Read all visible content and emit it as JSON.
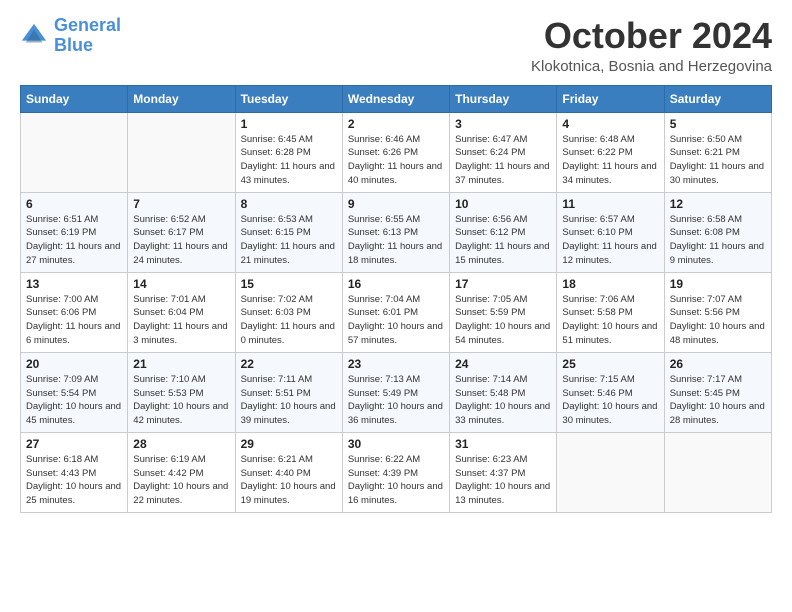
{
  "logo": {
    "line1": "General",
    "line2": "Blue"
  },
  "header": {
    "month": "October 2024",
    "location": "Klokotnica, Bosnia and Herzegovina"
  },
  "weekdays": [
    "Sunday",
    "Monday",
    "Tuesday",
    "Wednesday",
    "Thursday",
    "Friday",
    "Saturday"
  ],
  "weeks": [
    [
      null,
      null,
      {
        "day": "1",
        "sunrise": "6:45 AM",
        "sunset": "6:28 PM",
        "daylight": "11 hours and 43 minutes."
      },
      {
        "day": "2",
        "sunrise": "6:46 AM",
        "sunset": "6:26 PM",
        "daylight": "11 hours and 40 minutes."
      },
      {
        "day": "3",
        "sunrise": "6:47 AM",
        "sunset": "6:24 PM",
        "daylight": "11 hours and 37 minutes."
      },
      {
        "day": "4",
        "sunrise": "6:48 AM",
        "sunset": "6:22 PM",
        "daylight": "11 hours and 34 minutes."
      },
      {
        "day": "5",
        "sunrise": "6:50 AM",
        "sunset": "6:21 PM",
        "daylight": "11 hours and 30 minutes."
      }
    ],
    [
      {
        "day": "6",
        "sunrise": "6:51 AM",
        "sunset": "6:19 PM",
        "daylight": "11 hours and 27 minutes."
      },
      {
        "day": "7",
        "sunrise": "6:52 AM",
        "sunset": "6:17 PM",
        "daylight": "11 hours and 24 minutes."
      },
      {
        "day": "8",
        "sunrise": "6:53 AM",
        "sunset": "6:15 PM",
        "daylight": "11 hours and 21 minutes."
      },
      {
        "day": "9",
        "sunrise": "6:55 AM",
        "sunset": "6:13 PM",
        "daylight": "11 hours and 18 minutes."
      },
      {
        "day": "10",
        "sunrise": "6:56 AM",
        "sunset": "6:12 PM",
        "daylight": "11 hours and 15 minutes."
      },
      {
        "day": "11",
        "sunrise": "6:57 AM",
        "sunset": "6:10 PM",
        "daylight": "11 hours and 12 minutes."
      },
      {
        "day": "12",
        "sunrise": "6:58 AM",
        "sunset": "6:08 PM",
        "daylight": "11 hours and 9 minutes."
      }
    ],
    [
      {
        "day": "13",
        "sunrise": "7:00 AM",
        "sunset": "6:06 PM",
        "daylight": "11 hours and 6 minutes."
      },
      {
        "day": "14",
        "sunrise": "7:01 AM",
        "sunset": "6:04 PM",
        "daylight": "11 hours and 3 minutes."
      },
      {
        "day": "15",
        "sunrise": "7:02 AM",
        "sunset": "6:03 PM",
        "daylight": "11 hours and 0 minutes."
      },
      {
        "day": "16",
        "sunrise": "7:04 AM",
        "sunset": "6:01 PM",
        "daylight": "10 hours and 57 minutes."
      },
      {
        "day": "17",
        "sunrise": "7:05 AM",
        "sunset": "5:59 PM",
        "daylight": "10 hours and 54 minutes."
      },
      {
        "day": "18",
        "sunrise": "7:06 AM",
        "sunset": "5:58 PM",
        "daylight": "10 hours and 51 minutes."
      },
      {
        "day": "19",
        "sunrise": "7:07 AM",
        "sunset": "5:56 PM",
        "daylight": "10 hours and 48 minutes."
      }
    ],
    [
      {
        "day": "20",
        "sunrise": "7:09 AM",
        "sunset": "5:54 PM",
        "daylight": "10 hours and 45 minutes."
      },
      {
        "day": "21",
        "sunrise": "7:10 AM",
        "sunset": "5:53 PM",
        "daylight": "10 hours and 42 minutes."
      },
      {
        "day": "22",
        "sunrise": "7:11 AM",
        "sunset": "5:51 PM",
        "daylight": "10 hours and 39 minutes."
      },
      {
        "day": "23",
        "sunrise": "7:13 AM",
        "sunset": "5:49 PM",
        "daylight": "10 hours and 36 minutes."
      },
      {
        "day": "24",
        "sunrise": "7:14 AM",
        "sunset": "5:48 PM",
        "daylight": "10 hours and 33 minutes."
      },
      {
        "day": "25",
        "sunrise": "7:15 AM",
        "sunset": "5:46 PM",
        "daylight": "10 hours and 30 minutes."
      },
      {
        "day": "26",
        "sunrise": "7:17 AM",
        "sunset": "5:45 PM",
        "daylight": "10 hours and 28 minutes."
      }
    ],
    [
      {
        "day": "27",
        "sunrise": "6:18 AM",
        "sunset": "4:43 PM",
        "daylight": "10 hours and 25 minutes."
      },
      {
        "day": "28",
        "sunrise": "6:19 AM",
        "sunset": "4:42 PM",
        "daylight": "10 hours and 22 minutes."
      },
      {
        "day": "29",
        "sunrise": "6:21 AM",
        "sunset": "4:40 PM",
        "daylight": "10 hours and 19 minutes."
      },
      {
        "day": "30",
        "sunrise": "6:22 AM",
        "sunset": "4:39 PM",
        "daylight": "10 hours and 16 minutes."
      },
      {
        "day": "31",
        "sunrise": "6:23 AM",
        "sunset": "4:37 PM",
        "daylight": "10 hours and 13 minutes."
      },
      null,
      null
    ]
  ]
}
